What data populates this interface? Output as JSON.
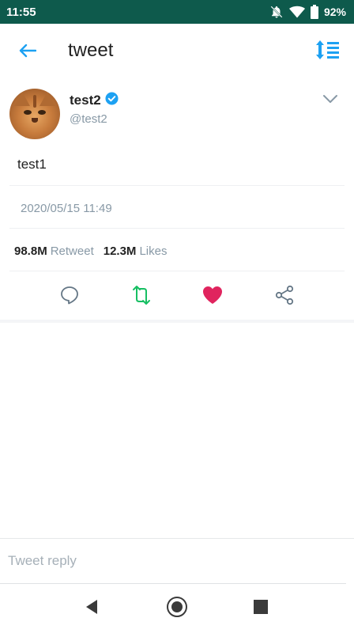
{
  "status_bar": {
    "time": "11:55",
    "battery": "92%"
  },
  "app_bar": {
    "title": "tweet"
  },
  "tweet": {
    "display_name": "test2",
    "handle": "@test2",
    "text": "test1",
    "timestamp": "2020/05/15 11:49",
    "retweet_count": "98.8M",
    "retweet_label": "Retweet",
    "like_count": "12.3M",
    "like_label": "Likes"
  },
  "reply": {
    "placeholder": "Tweet reply",
    "value": ""
  },
  "icons": {
    "back": "arrow-left-icon",
    "sort": "sort-list-icon",
    "verified": "verified-badge-icon",
    "menu": "chevron-down-icon",
    "reply": "comment-icon",
    "retweet": "retweet-icon",
    "like": "heart-icon",
    "share": "share-icon"
  },
  "colors": {
    "status_bar": "#0e5a4c",
    "accent": "#1da1f2",
    "retweet": "#17bf63",
    "like": "#e0245e",
    "muted_text": "#8899a6"
  }
}
